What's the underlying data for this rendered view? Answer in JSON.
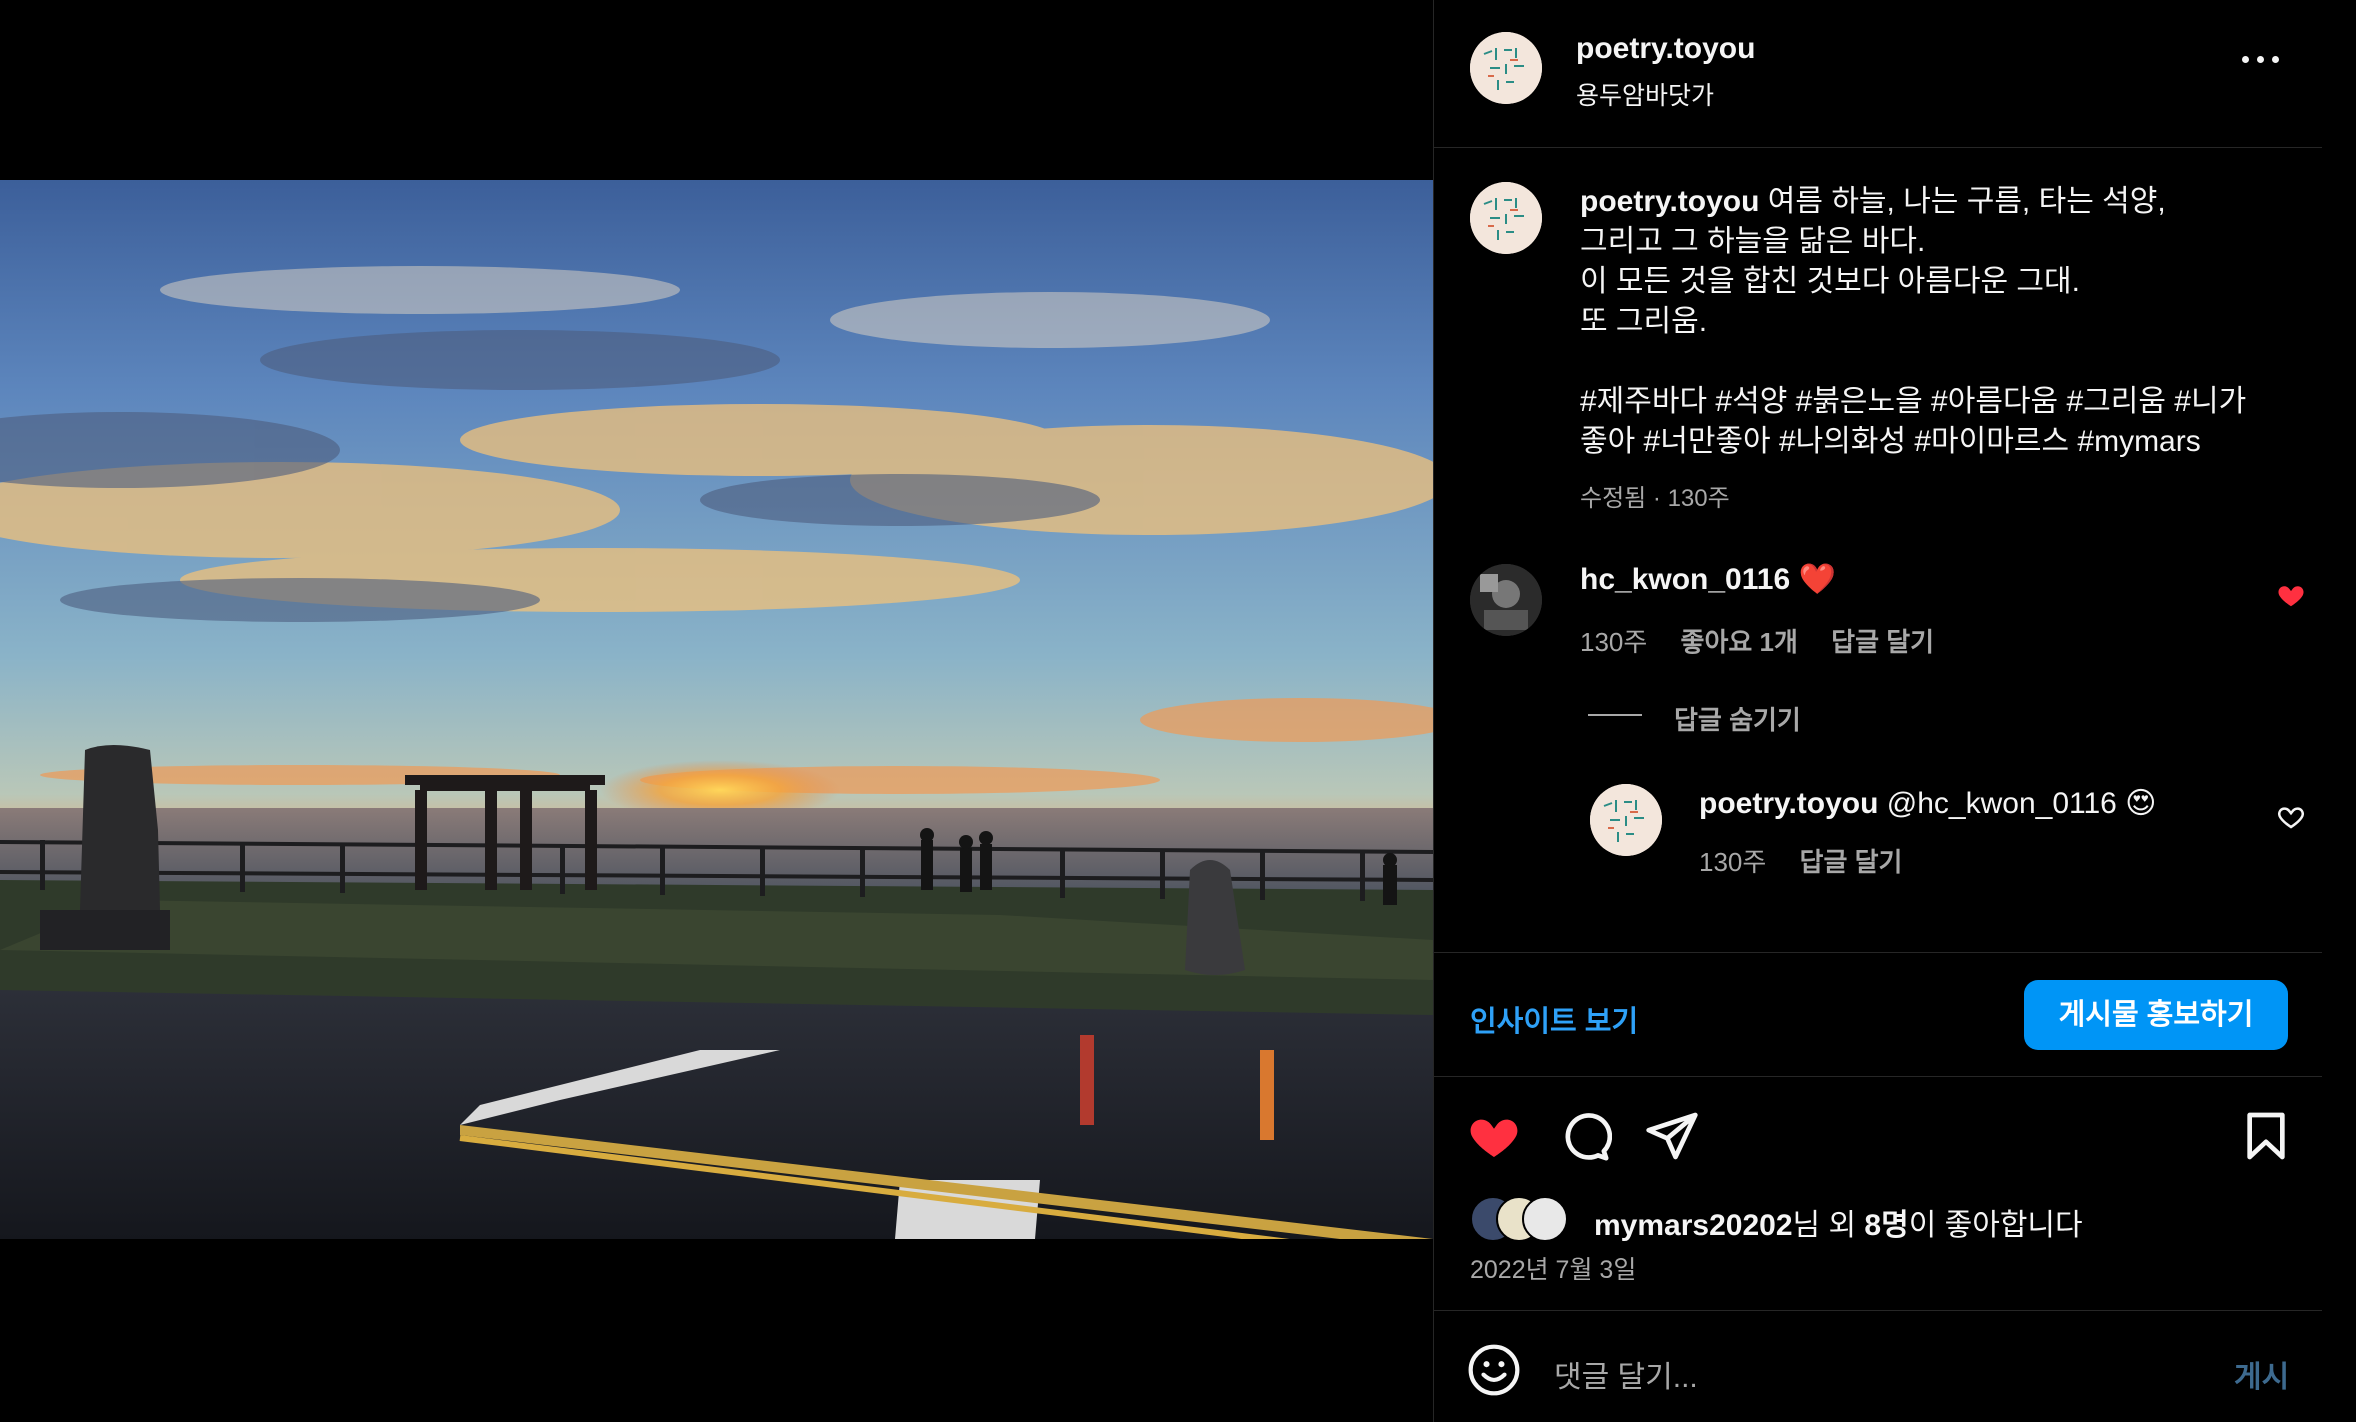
{
  "post": {
    "username": "poetry.toyou",
    "location": "용두암바닷가",
    "caption": "여름 하늘, 나는 구름, 타는 석양,\n그리고 그 하늘을 닮은 바다.\n이 모든 것을 합친 것보다 아름다운 그대.\n또 그리움.\n\n#제주바다 #석양 #붉은노을 #아름다움 #그리움 #니가 좋아 #너만좋아 #나의화성 #마이마르스 #mymars",
    "caption_meta": "수정됨 · 130주"
  },
  "comment": {
    "username": "hc_kwon_0116",
    "text": "❤️",
    "age": "130주",
    "likes": "좋아요 1개",
    "reply": "답글 달기",
    "liked": true
  },
  "hide_replies": "답글 숨기기",
  "reply": {
    "username": "poetry.toyou",
    "text": "@hc_kwon_0116 😍",
    "age": "130주",
    "reply": "답글 달기"
  },
  "insights_label": "인사이트 보기",
  "promote_label": "게시물 홍보하기",
  "likes": {
    "liker": "mymars20202",
    "suffix_a": "님 외 ",
    "others": "8명",
    "suffix_b": "이 좋아합니다"
  },
  "date": "2022년 7월 3일",
  "comment_box": {
    "placeholder": "댓글 달기...",
    "post_label": "게시"
  },
  "colors": {
    "accent": "#0095f6",
    "like_red": "#ff3040",
    "muted_text": "#a8a8a8"
  },
  "icons": [
    "more-icon",
    "heart-filled-icon",
    "comment-icon",
    "share-icon",
    "bookmark-icon",
    "emoji-icon",
    "heart-outline-icon"
  ]
}
